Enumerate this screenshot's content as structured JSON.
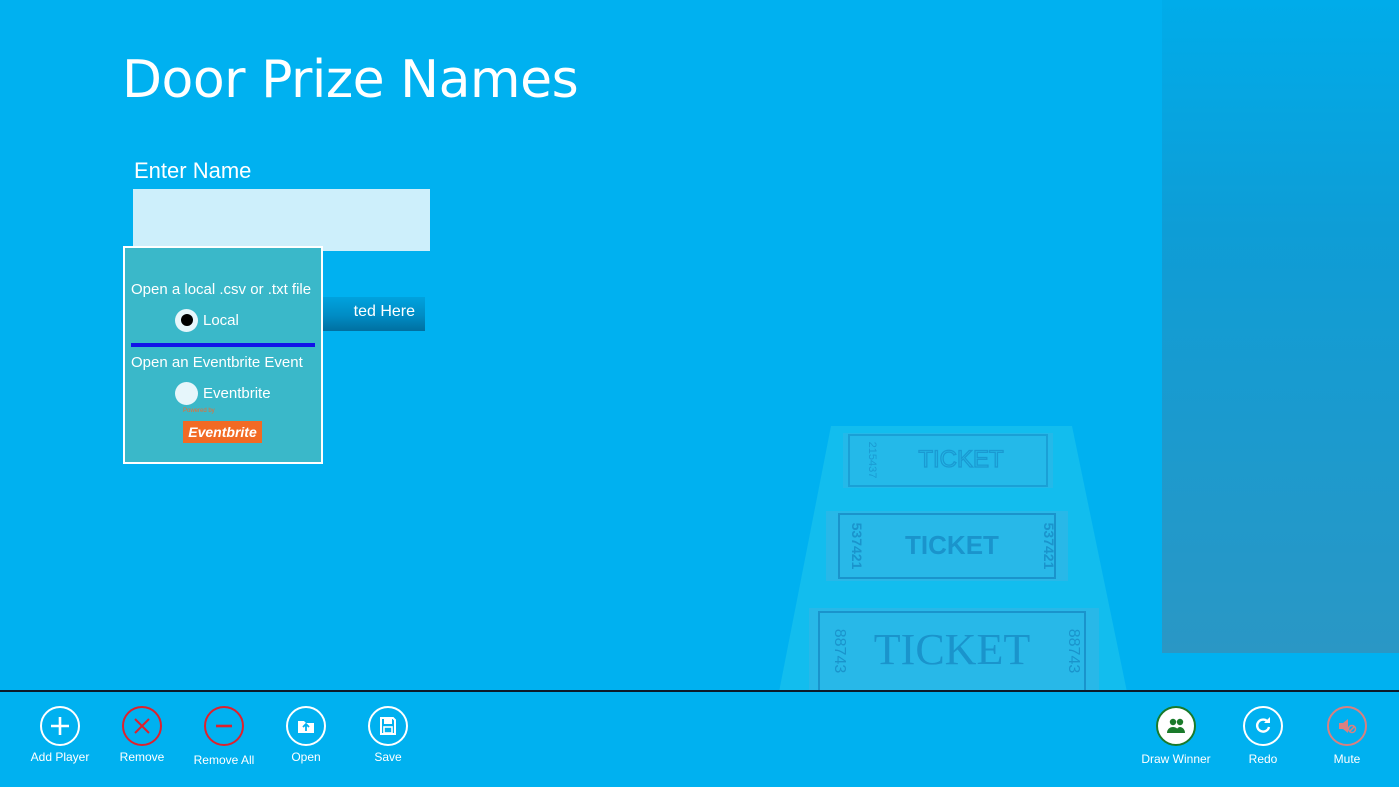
{
  "page": {
    "title": "Door Prize Names"
  },
  "entry": {
    "label": "Enter Name",
    "value": "",
    "list_header": "ted Here"
  },
  "open_popup": {
    "local_prompt": "Open a local .csv or .txt file",
    "local_option": {
      "label": "Local",
      "selected": true
    },
    "eventbrite_prompt": "Open an Eventbrite Event",
    "eventbrite_option": {
      "label": "Eventbrite",
      "selected": false
    },
    "eventbrite_logo_caption": "Powered by",
    "eventbrite_logo_text": "Eventbrite"
  },
  "background": {
    "ticket_text": "TICKET",
    "ticket_number_1": "215437",
    "ticket_number_2": "537421",
    "ticket_number_3": "88743"
  },
  "app_bar": {
    "left": [
      {
        "label": "Add Player",
        "icon": "add-icon"
      },
      {
        "label": "Remove",
        "icon": "x-icon",
        "color": "#e0202c"
      },
      {
        "label": "Remove All",
        "icon": "minus-icon",
        "color": "#e0202c"
      },
      {
        "label": "Open",
        "icon": "open-folder-icon"
      },
      {
        "label": "Save",
        "icon": "save-icon"
      }
    ],
    "right": [
      {
        "label": "Draw Winner",
        "icon": "people-icon",
        "color": "#1a7a2a"
      },
      {
        "label": "Redo",
        "icon": "redo-icon"
      },
      {
        "label": "Mute",
        "icon": "mute-icon",
        "color": "#d98080"
      }
    ]
  },
  "colors": {
    "background": "#00b1f0",
    "popup": "#3ab8c9",
    "divider": "#1212e8",
    "eventbrite": "#f26a24"
  }
}
